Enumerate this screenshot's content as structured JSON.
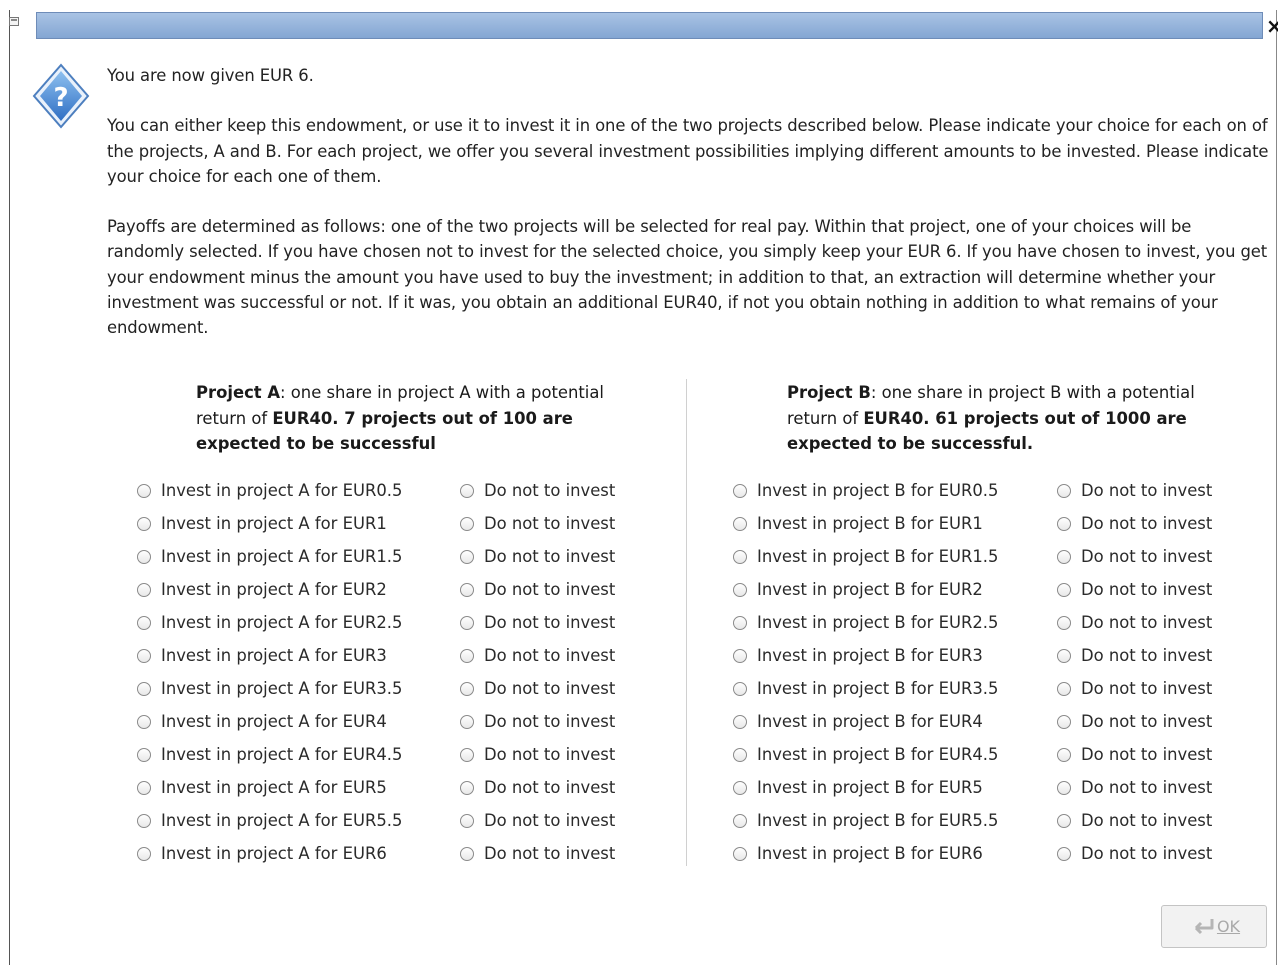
{
  "dialog": {
    "title": "",
    "icon": "question-icon",
    "message": [
      "You are now given EUR 6.",
      "You can either keep this endowment, or use it to invest it in one of the two projects described below. Please indicate your choice for each on of the projects, A and B. For each project, we offer you several investment possibilities implying different amounts to be invested. Please indicate your choice for each one of them.",
      "Payoffs are determined as follows: one of the two projects will be selected for real pay. Within that project, one of your choices will be randomly selected. If you have chosen not to invest for the selected choice, you simply keep your EUR 6. If you have chosen to invest, you get your endowment minus the amount you have used to buy the investment; in addition to that, an extraction will determine whether your investment was successful or not. If it was, you obtain an additional EUR40, if not you obtain nothing in addition to what remains of your endowment."
    ]
  },
  "projects": [
    {
      "name": "Project A",
      "desc_mid": ": one share in project A with a potential return of ",
      "return_bold": "EUR40. 7 projects out of 100 are expected to be successful",
      "invest_options": [
        "Invest in project A for EUR0.5",
        "Invest in project A for EUR1",
        "Invest in project A for EUR1.5",
        "Invest in project A for EUR2",
        "Invest in project A for EUR2.5",
        "Invest in project A for EUR3",
        "Invest in project A for EUR3.5",
        "Invest in project A for EUR4",
        "Invest in project A for EUR4.5",
        "Invest in project A for EUR5",
        "Invest in project A for EUR5.5",
        "Invest in project A for EUR6"
      ],
      "no_invest_label": "Do not to invest"
    },
    {
      "name": "Project B",
      "desc_mid": ": one share in project B with a potential return of ",
      "return_bold": "EUR40. 61 projects out of 1000 are expected to be successful.",
      "invest_options": [
        "Invest in project B for EUR0.5",
        "Invest in project B for EUR1",
        "Invest in project B for EUR1.5",
        "Invest in project B for EUR2",
        "Invest in project B for EUR2.5",
        "Invest in project B for EUR3",
        "Invest in project B for EUR3.5",
        "Invest in project B for EUR4",
        "Invest in project B for EUR4.5",
        "Invest in project B for EUR5",
        "Invest in project B for EUR5.5",
        "Invest in project B for EUR6"
      ],
      "no_invest_label": "Do not to invest"
    }
  ],
  "ok_button": {
    "label": "OK",
    "enabled": false,
    "icon": "ok-arrow-icon"
  },
  "colors": {
    "titlebar": "#94b3dc",
    "text": "#222222",
    "icon_blue": "#3b7fd1"
  }
}
